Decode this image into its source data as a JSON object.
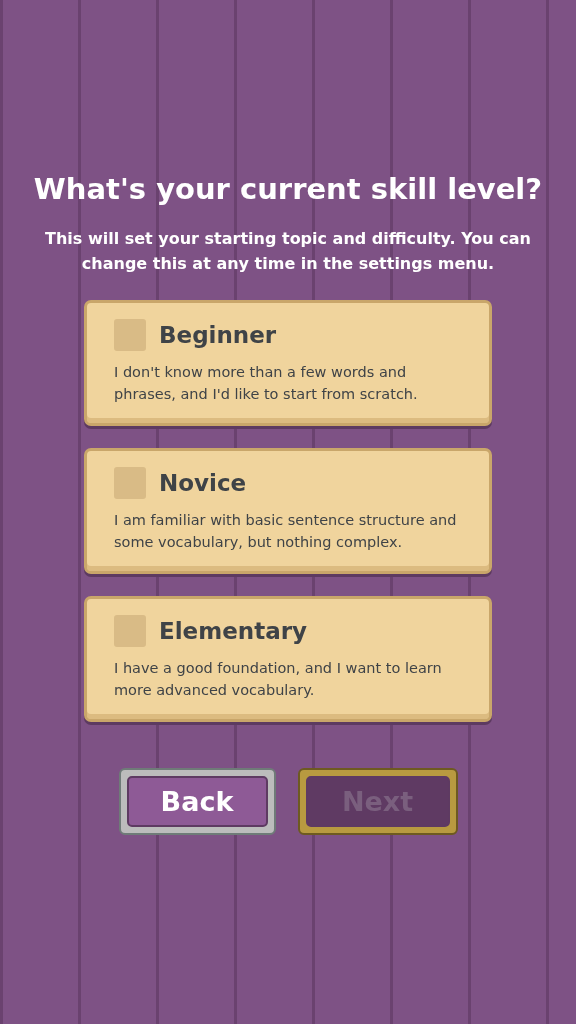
{
  "title": "What's your current skill level?",
  "subtitle": "This will set your starting topic and difficulty. You can change this at any time in the settings menu.",
  "options": [
    {
      "label": "Beginner",
      "description": "I don't know more than a few words and phrases, and I'd like to start from scratch.",
      "checked": false
    },
    {
      "label": "Novice",
      "description": "I am familiar with basic sentence structure and some vocabulary, but nothing complex.",
      "checked": false
    },
    {
      "label": "Elementary",
      "description": "I have a good foundation, and I want to learn more advanced vocabulary.",
      "checked": false
    }
  ],
  "buttons": [
    {
      "label": "Back",
      "kind": "silver",
      "disabled": false
    },
    {
      "label": "Next",
      "kind": "gold",
      "disabled": true
    }
  ]
}
